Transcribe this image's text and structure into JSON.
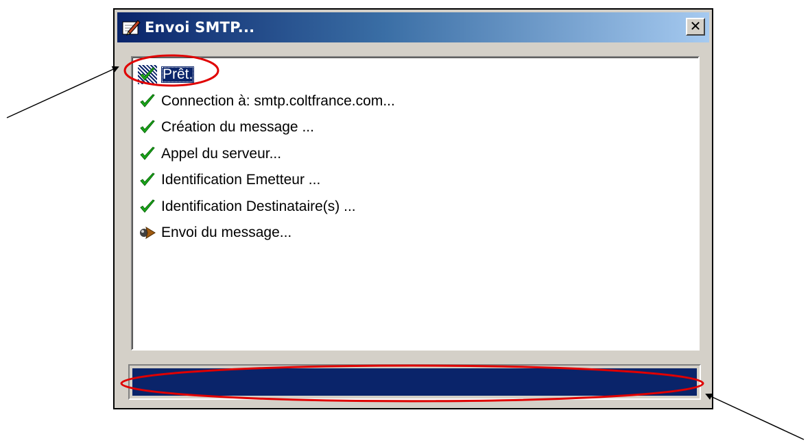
{
  "window": {
    "title": "Envoi SMTP...",
    "close_label": "✕"
  },
  "log": {
    "items": [
      {
        "label": "Prêt.",
        "icon": "checkmark-icon",
        "selected": true
      },
      {
        "label": "Connection à: smtp.coltfrance.com...",
        "icon": "checkmark-icon"
      },
      {
        "label": "Création du message ...",
        "icon": "checkmark-icon"
      },
      {
        "label": "Appel du serveur...",
        "icon": "checkmark-icon"
      },
      {
        "label": "Identification Emetteur ...",
        "icon": "checkmark-icon"
      },
      {
        "label": "Identification Destinataire(s) ...",
        "icon": "checkmark-icon"
      },
      {
        "label": "Envoi du message...",
        "icon": "sending-arrow-icon"
      }
    ]
  },
  "progress": {
    "value_percent": 100
  },
  "colors": {
    "titlebar_start": "#0a246a",
    "titlebar_end": "#a6caf0",
    "window_bg": "#d4d0c8",
    "progress_fill": "#0a246a",
    "check_green": "#1aa81a",
    "annotation_red": "#e00000"
  }
}
